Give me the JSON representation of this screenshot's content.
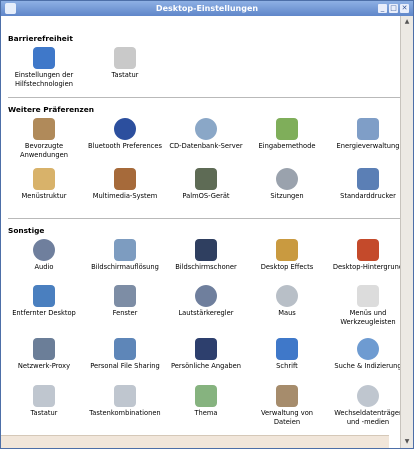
{
  "window": {
    "title": "Desktop-Einstellungen",
    "buttons": [
      "_",
      "□",
      "✕"
    ]
  },
  "sections": [
    {
      "title": "Barrierefreiheit",
      "items": [
        {
          "label": "Einstellungen der Hilfstechnologien",
          "icon": "accessibility-icon"
        },
        {
          "label": "Tastatur",
          "icon": "keyboard-icon"
        }
      ]
    },
    {
      "title": "Weitere Präferenzen",
      "items": [
        {
          "label": "Bevorzugte Anwendungen",
          "icon": "preferred-apps-icon"
        },
        {
          "label": "Bluetooth Preferences",
          "icon": "bluetooth-icon"
        },
        {
          "label": "CD-Datenbank-Server",
          "icon": "cd-database-icon"
        },
        {
          "label": "Eingabemethode",
          "icon": "input-method-icon"
        },
        {
          "label": "Energieverwaltung",
          "icon": "power-icon"
        },
        {
          "label": "Menüstruktur",
          "icon": "menu-editor-icon"
        },
        {
          "label": "Multimedia-System",
          "icon": "multimedia-icon"
        },
        {
          "label": "PalmOS-Gerät",
          "icon": "palm-icon"
        },
        {
          "label": "Sitzungen",
          "icon": "sessions-icon"
        },
        {
          "label": "Standarddrucker",
          "icon": "printer-icon"
        }
      ]
    },
    {
      "title": "Sonstige",
      "items": [
        {
          "label": "Audio",
          "icon": "audio-icon"
        },
        {
          "label": "Bildschirmauflösung",
          "icon": "resolution-icon"
        },
        {
          "label": "Bildschirmschoner",
          "icon": "screensaver-icon"
        },
        {
          "label": "Desktop Effects",
          "icon": "desktop-effects-icon"
        },
        {
          "label": "Desktop-Hintergrund",
          "icon": "background-icon"
        },
        {
          "label": "Entfernter Desktop",
          "icon": "remote-desktop-icon"
        },
        {
          "label": "Fenster",
          "icon": "window-icon"
        },
        {
          "label": "Lautstärkeregler",
          "icon": "volume-icon"
        },
        {
          "label": "Maus",
          "icon": "mouse-icon"
        },
        {
          "label": "Menüs und Werkzeugleisten",
          "icon": "menus-toolbars-icon"
        },
        {
          "label": "Netzwerk-Proxy",
          "icon": "proxy-icon"
        },
        {
          "label": "Personal File Sharing",
          "icon": "file-sharing-icon"
        },
        {
          "label": "Persönliche Angaben",
          "icon": "personal-info-icon"
        },
        {
          "label": "Schrift",
          "icon": "font-icon"
        },
        {
          "label": "Suche & Indizierung",
          "icon": "search-icon"
        },
        {
          "label": "Tastatur",
          "icon": "keyboard-icon"
        },
        {
          "label": "Tastenkombinationen",
          "icon": "shortcuts-icon"
        },
        {
          "label": "Thema",
          "icon": "theme-icon"
        },
        {
          "label": "Verwaltung von Dateien",
          "icon": "file-management-icon"
        },
        {
          "label": "Wechseldatenträger und -medien",
          "icon": "removable-media-icon"
        }
      ]
    }
  ],
  "colors": {
    "accessibility-icon": "#3f78c9",
    "keyboard-icon": "#c9c9c9",
    "preferred-apps-icon": "#b08a5a",
    "bluetooth-icon": "#2c4f9e",
    "cd-database-icon": "#8aa7c7",
    "input-method-icon": "#7fae5a",
    "power-icon": "#7f9ec7",
    "menu-editor-icon": "#d8b26a",
    "multimedia-icon": "#a66a3a",
    "palm-icon": "#5e6b55",
    "sessions-icon": "#9aa2ad",
    "printer-icon": "#5b7fb5",
    "audio-icon": "#6f7f9d",
    "resolution-icon": "#7d9cc0",
    "screensaver-icon": "#2f3f60",
    "desktop-effects-icon": "#c99a40",
    "background-icon": "#c44a2b",
    "remote-desktop-icon": "#4a7fbf",
    "window-icon": "#7d8da5",
    "volume-icon": "#6f7f9d",
    "mouse-icon": "#b8bfc7",
    "menus-toolbars-icon": "#dcdcdc",
    "proxy-icon": "#6b7e98",
    "file-sharing-icon": "#5e86b8",
    "personal-info-icon": "#2d3f6d",
    "font-icon": "#3f78c9",
    "search-icon": "#6e9bd1",
    "shortcuts-icon": "#bfc6cf",
    "theme-icon": "#86b37f",
    "file-management-icon": "#a68c6c",
    "removable-media-icon": "#bfc6cf"
  }
}
